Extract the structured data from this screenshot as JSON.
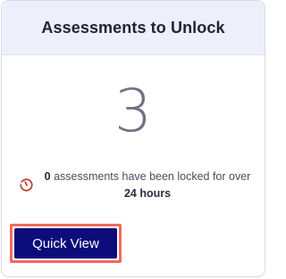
{
  "card": {
    "title": "Assessments to Unlock",
    "count": "3"
  },
  "lock_info": {
    "icon": "clock-icon",
    "icon_color": "#c0392b",
    "locked_count": "0",
    "text_middle": " assessments have been locked for over ",
    "duration": "24 hours"
  },
  "actions": {
    "quick_view_label": "Quick View"
  },
  "colors": {
    "header_bg": "#edf0fb",
    "button_bg": "#0c0d7b",
    "button_outline": "#f26a5b"
  }
}
